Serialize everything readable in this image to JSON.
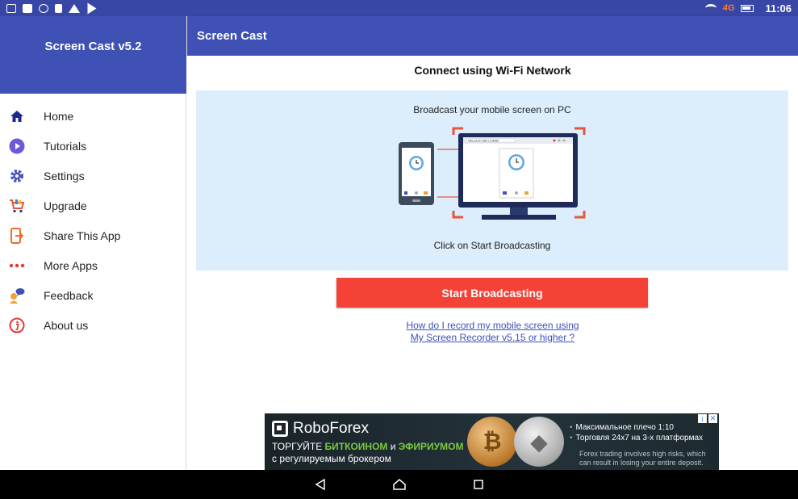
{
  "status_bar": {
    "time": "11:06",
    "network": "4G"
  },
  "drawer": {
    "title": "Screen Cast v5.2",
    "items": [
      {
        "label": "Home",
        "icon": "home-icon",
        "color": "#1b2a8a"
      },
      {
        "label": "Tutorials",
        "icon": "play-circle-icon",
        "color": "#6a5cd8"
      },
      {
        "label": "Settings",
        "icon": "gear-icon",
        "color": "#4b56b8"
      },
      {
        "label": "Upgrade",
        "icon": "cart-icon",
        "color": "#e8553b"
      },
      {
        "label": "Share This App",
        "icon": "share-phone-icon",
        "color": "#f26a2e"
      },
      {
        "label": "More Apps",
        "icon": "dots-icon",
        "color": "#e53935"
      },
      {
        "label": "Feedback",
        "icon": "feedback-icon",
        "color": "#f0a23a"
      },
      {
        "label": "About us",
        "icon": "info-icon",
        "color": "#e53935"
      }
    ]
  },
  "app_bar": {
    "title": "Screen Cast"
  },
  "main": {
    "connect_title": "Connect using Wi-Fi Network",
    "info_caption": "Broadcast your mobile screen on PC",
    "browser_url": "http://192.168.1.5:8080",
    "info_sub": "Click on Start Broadcasting",
    "start_button": "Start Broadcasting",
    "help_link_line1": "How do I record my mobile screen using",
    "help_link_line2": "My Screen Recorder v5.15 or higher ?"
  },
  "ad": {
    "brand": "RoboForex",
    "line1_a": "ТОРГУЙТЕ ",
    "line1_b": "БИТКОИНОМ",
    "line1_c": " и ",
    "line1_d": "ЭФИРИУМОМ",
    "line2": "с регулируемым брокером",
    "bullet1": "Максимальное плечо 1:10",
    "bullet2": "Торговля 24x7 на 3-х платформах",
    "disclaimer1": "Forex trading involves high risks, which",
    "disclaimer2": "can result in losing your entire deposit.",
    "bitcoin_symbol": "₿",
    "ether_symbol": "◆"
  },
  "colors": {
    "primary": "#3f51b5",
    "status": "#3846a6",
    "accent": "#f44336",
    "panel": "#dcedfb"
  }
}
